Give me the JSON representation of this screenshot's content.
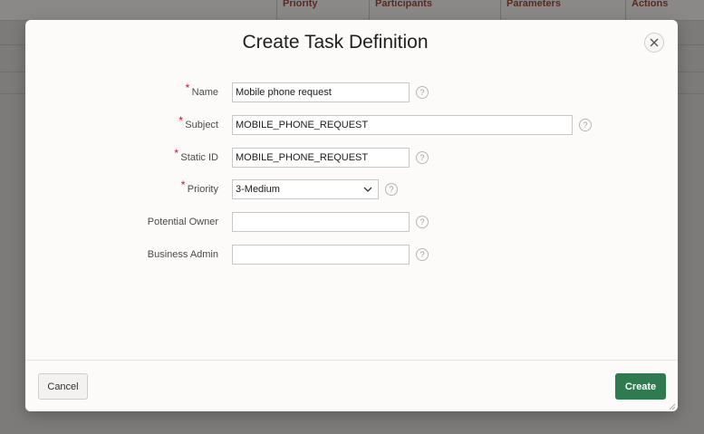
{
  "background_table": {
    "columns": [
      "Priority",
      "Participants",
      "Parameters",
      "Actions"
    ]
  },
  "dialog": {
    "title": "Create Task Definition",
    "close_icon": "close-icon",
    "fields": {
      "name": {
        "label": "Name",
        "value": "Mobile phone request",
        "required": "*"
      },
      "subject": {
        "label": "Subject",
        "value": "MOBILE_PHONE_REQUEST",
        "required": "*"
      },
      "static_id": {
        "label": "Static ID",
        "value": "MOBILE_PHONE_REQUEST",
        "required": "*"
      },
      "priority": {
        "label": "Priority",
        "value": "3-Medium",
        "required": "*"
      },
      "potential_owner": {
        "label": "Potential Owner",
        "value": ""
      },
      "business_admin": {
        "label": "Business Admin",
        "value": ""
      }
    },
    "help_icon": "help-icon",
    "help_glyph": "?",
    "buttons": {
      "cancel": "Cancel",
      "create": "Create"
    },
    "colors": {
      "primary_button": "#2f7a4f",
      "required_marker": "#c8102e"
    }
  }
}
